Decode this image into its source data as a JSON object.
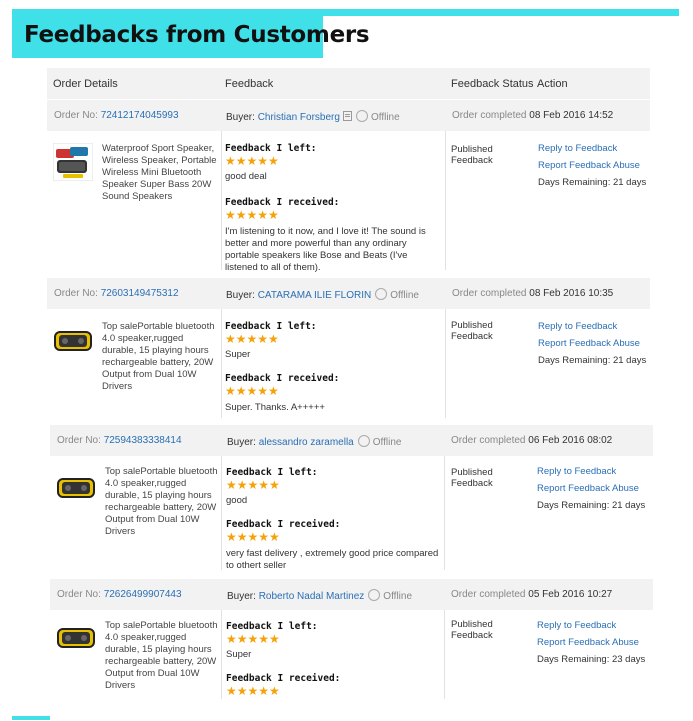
{
  "page_title": "Feedbacks from Customers",
  "header": {
    "order_details": "Order Details",
    "feedback": "Feedback",
    "feedback_status": "Feedback Status",
    "action": "Action"
  },
  "labels": {
    "order_no": "Order No:",
    "buyer": "Buyer:",
    "offline": "Offline",
    "order_completed": "Order completed",
    "feedback_left": "Feedback I left:",
    "feedback_received": "Feedback I received:",
    "reply": "Reply to Feedback",
    "report": "Report Feedback Abuse"
  },
  "colors": {
    "accent": "#40e0e8",
    "link": "#2a6fb5",
    "star": "#f5a20a"
  },
  "orders": [
    {
      "order_no": "72412174045993",
      "buyer": "Christian Forsberg",
      "completed": "08 Feb 2016 14:52",
      "product": "Waterproof Sport Speaker, Wireless Speaker, Portable Wireless Mini Bluetooth Speaker Super Bass 20W Sound Speakers",
      "left_stars": "★★★★★",
      "left_text": "good deal",
      "received_stars": "★★★★★",
      "received_text": "I'm listening to it now, and I love it! The sound is better and more powerful than any ordinary portable speakers like Bose and Beats (I've listened to all of them).",
      "status": "Published Feedback",
      "days_remaining": "Days Remaining: 21 days"
    },
    {
      "order_no": "72603149475312",
      "buyer": "CATARAMA ILIE FLORIN",
      "completed": "08 Feb 2016 10:35",
      "product": "Top salePortable bluetooth 4.0 speaker,rugged durable, 15 playing hours rechargeable battery, 20W Output from Dual 10W Drivers",
      "left_stars": "★★★★★",
      "left_text": "Super",
      "received_stars": "★★★★★",
      "received_text": "Super. Thanks. A+++++",
      "status": "Published Feedback",
      "days_remaining": "Days Remaining: 21 days"
    },
    {
      "order_no": "72594383338414",
      "buyer": "alessandro zaramella",
      "completed": "06 Feb 2016 08:02",
      "product": "Top salePortable bluetooth 4.0 speaker,rugged durable, 15 playing hours rechargeable battery, 20W Output from Dual 10W Drivers",
      "left_stars": "★★★★★",
      "left_text": "good",
      "received_stars": "★★★★★",
      "received_text": "very fast delivery , extremely good price compared to othert seller",
      "status": "Published Feedback",
      "days_remaining": "Days Remaining: 21 days"
    },
    {
      "order_no": "72626499907443",
      "buyer": "Roberto Nadal Martinez",
      "completed": "05 Feb 2016 10:27",
      "product": "Top salePortable bluetooth 4.0 speaker,rugged durable, 15 playing hours rechargeable battery, 20W Output from Dual 10W Drivers",
      "left_stars": "★★★★★",
      "left_text": "Super",
      "received_stars": "★★★★★",
      "received_text": "",
      "status": "Published Feedback",
      "days_remaining": "Days Remaining: 23 days"
    }
  ]
}
